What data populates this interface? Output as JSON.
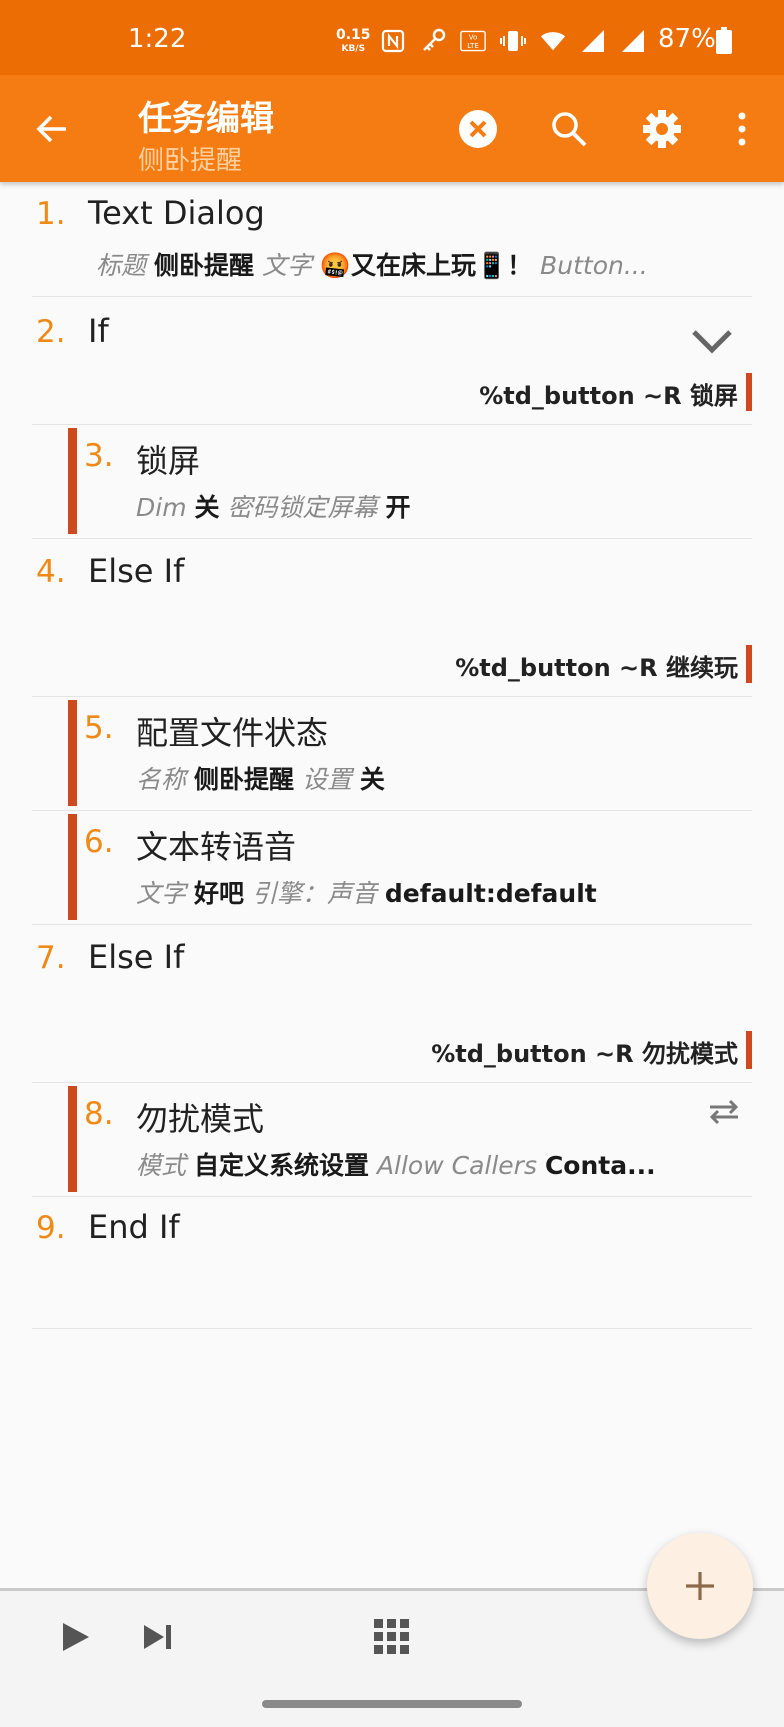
{
  "status_bar": {
    "time": "1:22",
    "net_speed": "0.15",
    "net_unit": "KB/S",
    "icons": [
      "nfc-icon",
      "key-icon",
      "volte-icon",
      "vibrate-icon",
      "wifi-icon",
      "signal-icon",
      "signal-icon"
    ],
    "battery": "87%"
  },
  "app_bar": {
    "title": "任务编辑",
    "subtitle": "侧卧提醒"
  },
  "actions": [
    {
      "num": "1.",
      "name": "Text Dialog",
      "params": [
        {
          "k": "标题",
          "v": "侧卧提醒"
        },
        {
          "k": "文字",
          "v": "🤬又在床上玩📱！"
        },
        {
          "k": "Button...",
          "v": ""
        }
      ]
    },
    {
      "num": "2.",
      "name": "If",
      "condition": "%td_button ~R 锁屏"
    },
    {
      "num": "3.",
      "name": "锁屏",
      "params": [
        {
          "k": "Dim",
          "v": "关"
        },
        {
          "k": "密码锁定屏幕",
          "v": "开"
        }
      ]
    },
    {
      "num": "4.",
      "name": "Else If",
      "condition": "%td_button ~R 继续玩"
    },
    {
      "num": "5.",
      "name": "配置文件状态",
      "params": [
        {
          "k": "名称",
          "v": "侧卧提醒"
        },
        {
          "k": "设置",
          "v": "关"
        }
      ]
    },
    {
      "num": "6.",
      "name": "文本转语音",
      "params": [
        {
          "k": "文字",
          "v": "好吧"
        },
        {
          "k": "引擎：声音",
          "v": "default:default"
        }
      ]
    },
    {
      "num": "7.",
      "name": "Else If",
      "condition": "%td_button ~R 勿扰模式"
    },
    {
      "num": "8.",
      "name": "勿扰模式",
      "params": [
        {
          "k": "模式",
          "v": "自定义系统设置"
        },
        {
          "k": "Allow Callers",
          "v": "Conta..."
        }
      ]
    },
    {
      "num": "9.",
      "name": "End If"
    }
  ],
  "colors": {
    "status_bar": "#ec6d04",
    "app_bar": "#f47c12",
    "number": "#ef8a17",
    "indent_bar": "#cd4a1f"
  }
}
